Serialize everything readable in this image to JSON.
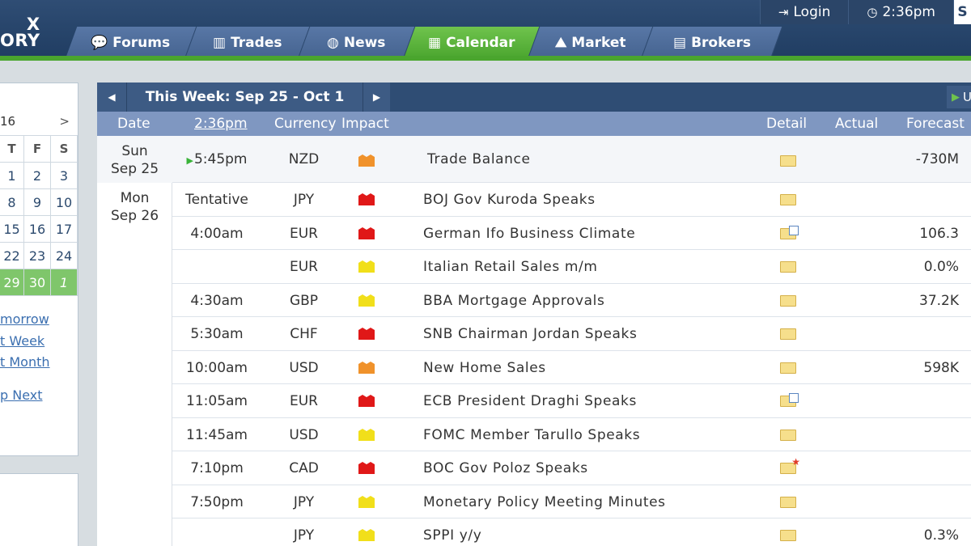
{
  "header": {
    "logo_line1": "X",
    "logo_line2": "ORY",
    "login_label": "Login",
    "clock_label": "2:36pm",
    "right_edge": "S",
    "tabs": [
      {
        "label": "Forums",
        "icon": "chat-bubbles-icon"
      },
      {
        "label": "Trades",
        "icon": "bar-chart-icon"
      },
      {
        "label": "News",
        "icon": "globe-icon"
      },
      {
        "label": "Calendar",
        "icon": "calendar-icon",
        "active": true
      },
      {
        "label": "Market",
        "icon": "line-chart-icon"
      },
      {
        "label": "Brokers",
        "icon": "building-icon"
      }
    ]
  },
  "minical": {
    "year_fragment": "16",
    "next": ">",
    "dows": [
      "T",
      "F",
      "S"
    ],
    "weeks": [
      [
        "1",
        "2",
        "3"
      ],
      [
        "8",
        "9",
        "10"
      ],
      [
        "15",
        "16",
        "17"
      ],
      [
        "22",
        "23",
        "24"
      ],
      [
        "29",
        "30",
        "1"
      ]
    ],
    "links": [
      "morrow",
      "t Week",
      "t Month",
      "p Next"
    ]
  },
  "calendar": {
    "week_title": "This Week: Sep 25 - Oct 1",
    "up_label": "U",
    "columns": {
      "date": "Date",
      "time": "2:36pm",
      "currency": "Currency",
      "impact": "Impact",
      "detail": "Detail",
      "actual": "Actual",
      "forecast": "Forecast"
    },
    "days": [
      {
        "dow": "Sun",
        "date": "Sep 25"
      },
      {
        "dow": "Mon",
        "date": "Sep 26"
      }
    ],
    "events": [
      {
        "time": "5:45pm",
        "currency": "NZD",
        "impact": "medium",
        "event": "Trade Balance",
        "detail": "folder",
        "actual": "",
        "forecast": "-730M",
        "upcoming": true
      },
      {
        "time": "Tentative",
        "currency": "JPY",
        "impact": "high",
        "event": "BOJ Gov Kuroda Speaks",
        "detail": "folder",
        "actual": "",
        "forecast": ""
      },
      {
        "time": "4:00am",
        "currency": "EUR",
        "impact": "high",
        "event": "German Ifo Business Climate",
        "detail": "folder-doc",
        "actual": "",
        "forecast": "106.3"
      },
      {
        "time": "",
        "currency": "EUR",
        "impact": "low",
        "event": "Italian Retail Sales m/m",
        "detail": "folder",
        "actual": "",
        "forecast": "0.0%"
      },
      {
        "time": "4:30am",
        "currency": "GBP",
        "impact": "low",
        "event": "BBA Mortgage Approvals",
        "detail": "folder",
        "actual": "",
        "forecast": "37.2K"
      },
      {
        "time": "5:30am",
        "currency": "CHF",
        "impact": "high",
        "event": "SNB Chairman Jordan Speaks",
        "detail": "folder",
        "actual": "",
        "forecast": ""
      },
      {
        "time": "10:00am",
        "currency": "USD",
        "impact": "medium",
        "event": "New Home Sales",
        "detail": "folder",
        "actual": "",
        "forecast": "598K"
      },
      {
        "time": "11:05am",
        "currency": "EUR",
        "impact": "high",
        "event": "ECB President Draghi Speaks",
        "detail": "folder-doc",
        "actual": "",
        "forecast": ""
      },
      {
        "time": "11:45am",
        "currency": "USD",
        "impact": "low",
        "event": "FOMC Member Tarullo Speaks",
        "detail": "folder",
        "actual": "",
        "forecast": ""
      },
      {
        "time": "7:10pm",
        "currency": "CAD",
        "impact": "high",
        "event": "BOC Gov Poloz Speaks",
        "detail": "folder-star",
        "actual": "",
        "forecast": ""
      },
      {
        "time": "7:50pm",
        "currency": "JPY",
        "impact": "low",
        "event": "Monetary Policy Meeting Minutes",
        "detail": "folder",
        "actual": "",
        "forecast": ""
      },
      {
        "time": "",
        "currency": "JPY",
        "impact": "low",
        "event": "SPPI y/y",
        "detail": "folder",
        "actual": "",
        "forecast": "0.3%"
      }
    ]
  }
}
